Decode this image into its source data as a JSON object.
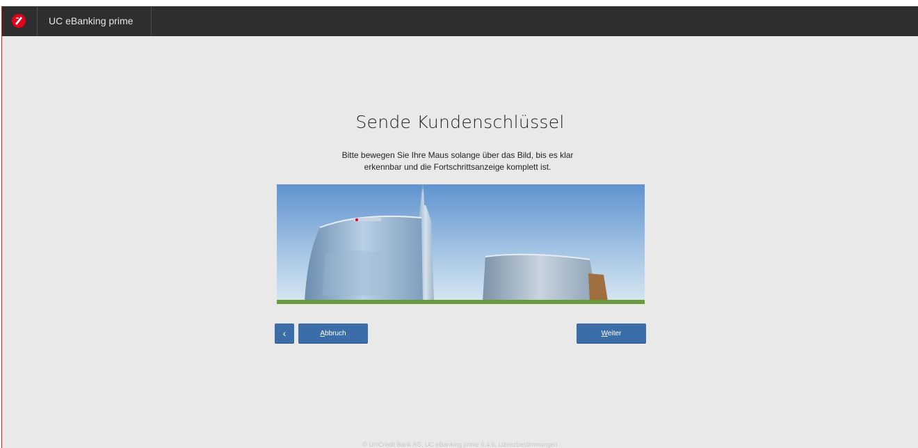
{
  "header": {
    "app_title": "UC eBanking prime",
    "logo_icon": "unicredit-logo-icon"
  },
  "main": {
    "title": "Sende Kundenschlüssel",
    "instructions_line1": "Bitte bewegen Sie Ihre Maus solange über das Bild, bis es klar",
    "instructions_line2": "erkennbar und die Fortschrittsanzeige komplett ist."
  },
  "buttons": {
    "back_icon": "chevron-left-icon",
    "cancel_first": "A",
    "cancel_rest": "bbruch",
    "next_first": "W",
    "next_rest": "eiter"
  },
  "footer": {
    "text": "© UniCredit Bank AG, UC eBanking prime 6.4.6, Lizenzbestimmungen"
  },
  "colors": {
    "header_bg": "#2e2e2e",
    "page_bg": "#e9e9ea",
    "button_bg": "#3b6ea8",
    "brand_red": "#e2001a"
  }
}
